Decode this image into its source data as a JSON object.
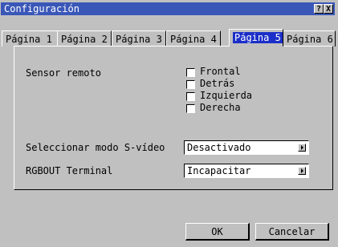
{
  "window": {
    "title": "Configuración",
    "help_label": "?",
    "close_label": "X"
  },
  "tabs": [
    {
      "label": "Página 1"
    },
    {
      "label": "Página 2"
    },
    {
      "label": "Página 3"
    },
    {
      "label": "Página 4"
    },
    {
      "label": "Página 5",
      "active": true
    },
    {
      "label": "Página 6"
    }
  ],
  "remote_sensor": {
    "label": "Sensor remoto",
    "options": [
      {
        "label": "Frontal",
        "checked": false
      },
      {
        "label": "Detrás",
        "checked": false
      },
      {
        "label": "Izquierda",
        "checked": false
      },
      {
        "label": "Derecha",
        "checked": false
      }
    ]
  },
  "svideo": {
    "label": "Seleccionar modo S-vídeo",
    "value": "Desactivado"
  },
  "rgbout": {
    "label": "RGBOUT Terminal",
    "value": "Incapacitar"
  },
  "buttons": {
    "ok": "OK",
    "cancel": "Cancelar"
  },
  "colors": {
    "titlebar": "#3a57b8",
    "face": "#c0c0c0",
    "active_tab_highlight": "#1c2fc8"
  }
}
